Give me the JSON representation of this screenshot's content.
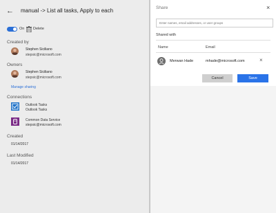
{
  "header": {
    "back_icon": "arrow-left",
    "title": "manual -> List all tasks, Apply to each"
  },
  "controls": {
    "on_label": "On",
    "delete_label": "Delete",
    "toggle_state": "on",
    "accent": "#2b6fd6"
  },
  "created_by": {
    "heading": "Created by",
    "name": "Stephen Siciliano",
    "email": "stepsic@microsoft.com"
  },
  "owners": {
    "heading": "Owners",
    "name": "Stephen Siciliano",
    "email": "stepsic@microsoft.com",
    "manage_link": "Manage sharing"
  },
  "connections": {
    "heading": "Connections",
    "items": [
      {
        "name": "Outlook Tasks",
        "detail": "Outlook Tasks",
        "icon": "outlook-tasks-icon",
        "color": "#1f72c8"
      },
      {
        "name": "Common Data Service",
        "detail": "stepsic@microsoft.com",
        "icon": "common-data-service-icon",
        "color": "#7a2b86"
      }
    ]
  },
  "created": {
    "heading": "Created",
    "date": "01/14/2017"
  },
  "last_modified": {
    "heading": "Last Modified",
    "date": "01/14/2017"
  },
  "share": {
    "title": "Share",
    "close_icon": "close-icon",
    "search_placeholder": "Enter names, email addresses, or user groups",
    "shared_with_label": "Shared with",
    "col_name": "Name",
    "col_email": "Email",
    "users": [
      {
        "name": "Merwan Hade",
        "email": "mhade@microsoft.com"
      }
    ],
    "cancel_label": "Cancel",
    "save_label": "Save",
    "save_color": "#2a73e8"
  }
}
